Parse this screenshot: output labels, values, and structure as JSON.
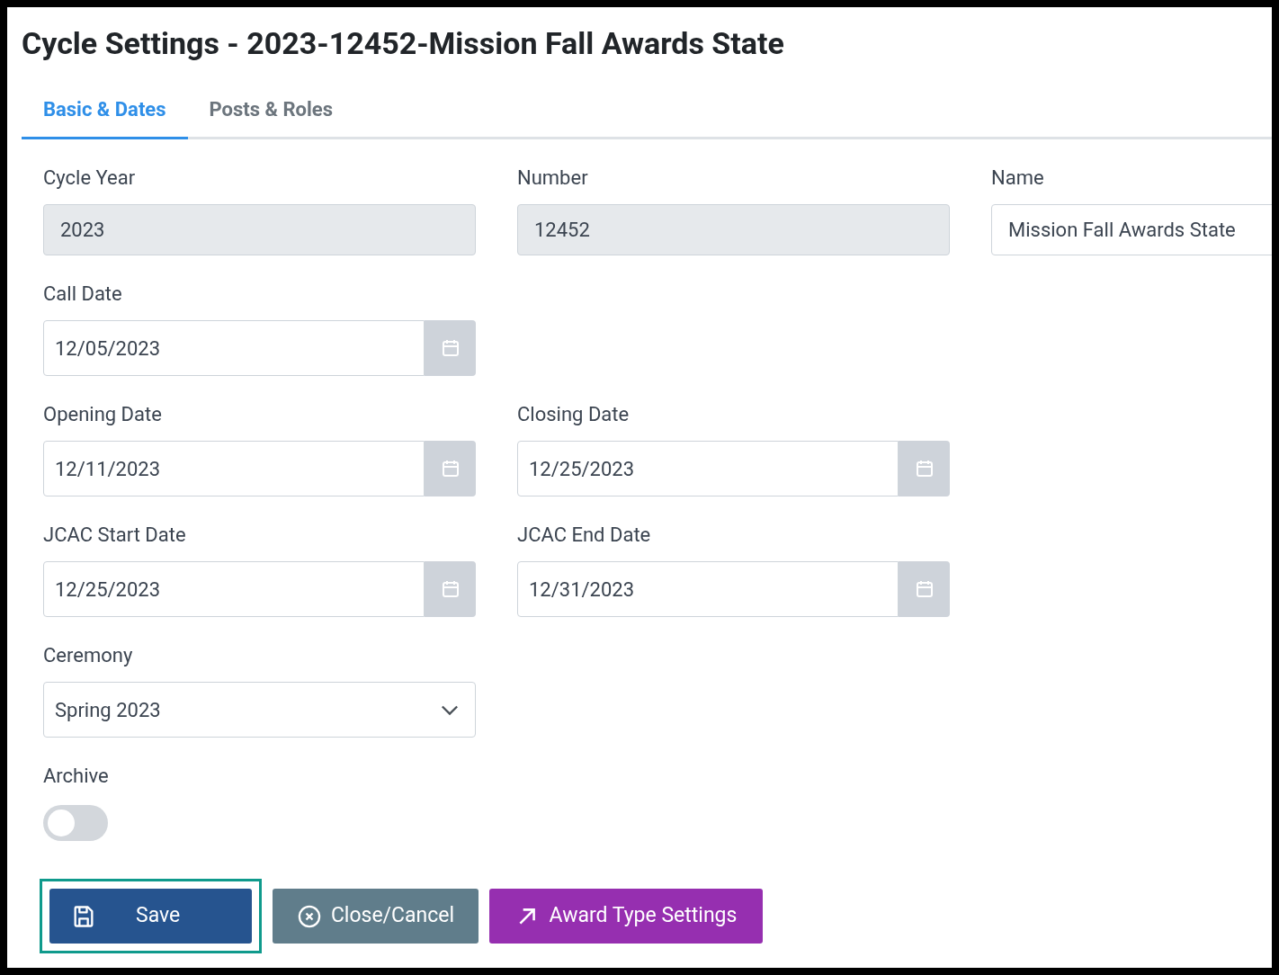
{
  "title": "Cycle Settings - 2023-12452-Mission Fall Awards State",
  "tabs": [
    {
      "label": "Basic & Dates",
      "selected": true
    },
    {
      "label": "Posts & Roles",
      "selected": false
    }
  ],
  "form_rows": [
    [
      {
        "kind": "text",
        "label": "Cycle Year",
        "value": "2023",
        "disabled": true
      },
      {
        "kind": "text",
        "label": "Number",
        "value": "12452",
        "disabled": true
      },
      {
        "kind": "text",
        "label": "Name",
        "value": "Mission Fall Awards State",
        "disabled": false
      }
    ],
    [
      {
        "kind": "date",
        "label": "Call Date",
        "value": "12/05/2023"
      }
    ],
    [
      {
        "kind": "date",
        "label": "Opening Date",
        "value": "12/11/2023"
      },
      {
        "kind": "date",
        "label": "Closing Date",
        "value": "12/25/2023"
      }
    ],
    [
      {
        "kind": "date",
        "label": "JCAC Start Date",
        "value": "12/25/2023"
      },
      {
        "kind": "date",
        "label": "JCAC End Date",
        "value": "12/31/2023"
      }
    ],
    [
      {
        "kind": "select",
        "label": "Ceremony",
        "value": "Spring 2023"
      }
    ],
    [
      {
        "kind": "toggle",
        "label": "Archive",
        "on": false
      }
    ]
  ],
  "buttons": [
    {
      "kind": "save",
      "label": "Save",
      "highlighted": true
    },
    {
      "kind": "cancel",
      "label": "Close/Cancel",
      "highlighted": false
    },
    {
      "kind": "link",
      "label": "Award Type Settings",
      "highlighted": false
    }
  ]
}
